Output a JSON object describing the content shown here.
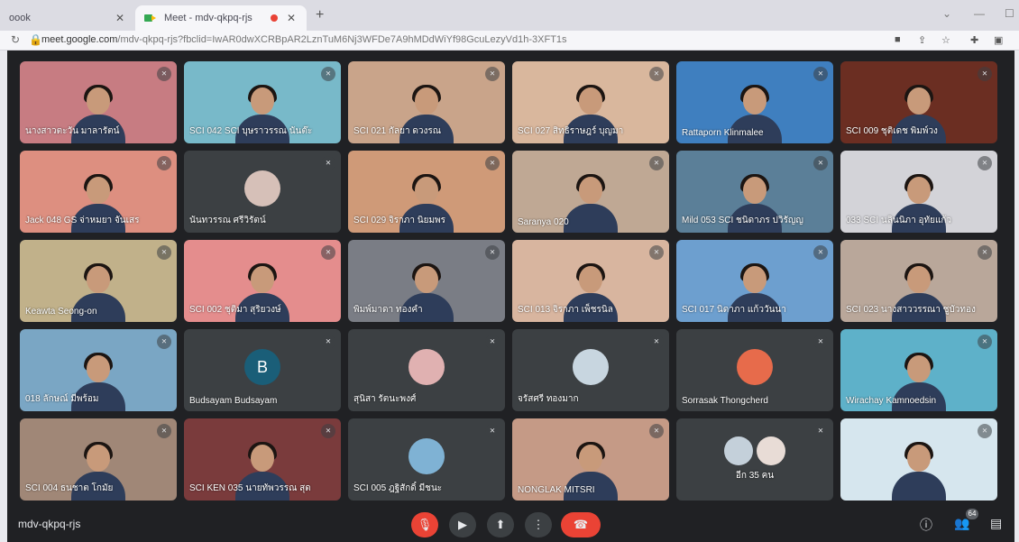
{
  "browser": {
    "tab_inactive": "oook",
    "tab_active": "Meet - mdv-qkpq-rjs",
    "url_host": "meet.google.com",
    "url_path": "/mdv-qkpq-rjs?fbclid=IwAR0dwXCRBpAR2LznTuM6Nj3WFDe7A9hMDdWiYf98GcuLezyVd1h-3XFT1s"
  },
  "meet": {
    "meeting_code": "mdv-qkpq-rjs",
    "participant_count": "64",
    "more_label": "อีก 35 คน",
    "tiles": [
      {
        "name": "นางสาวตะวัน มาลารัตน์",
        "bg": "#c77c82",
        "type": "video",
        "avatar": ""
      },
      {
        "name": "SCI 042 SCI บุษราวรรณ นันต๊ะ",
        "bg": "#78b9c9",
        "type": "video",
        "avatar": ""
      },
      {
        "name": "SCI 021 กัลยา ดวงรณ",
        "bg": "#c9a48a",
        "type": "video",
        "avatar": ""
      },
      {
        "name": "SCI 027 สิทธิราษฎร์ บุญมา",
        "bg": "#d9b79d",
        "type": "video",
        "avatar": ""
      },
      {
        "name": "Rattaporn Klinmalee",
        "bg": "#3f7fbf",
        "type": "video",
        "avatar": ""
      },
      {
        "name": "SCI 009 ชุติเดช พิมพ์วง",
        "bg": "#6b2e22",
        "type": "video",
        "avatar": ""
      },
      {
        "name": "Jack 048 GS จ่าหมยา จันเสร",
        "bg": "#dd8f80",
        "type": "video",
        "avatar": ""
      },
      {
        "name": "นันทวรรณ ศรีวิรัตน์",
        "bg": "#3c4043",
        "type": "avatar",
        "avatar": "",
        "avatar_bg": "#d6c0b8"
      },
      {
        "name": "SCI 029 จิราภา นิยมพร",
        "bg": "#cf9a78",
        "type": "video",
        "avatar": ""
      },
      {
        "name": "Saranya 020",
        "bg": "#bfa894",
        "type": "video",
        "avatar": ""
      },
      {
        "name": "Mild 053 SCI ชนิดาภร ปวิรัญญ",
        "bg": "#5b7f98",
        "type": "video",
        "avatar": ""
      },
      {
        "name": "033 SCI นลินนิภา อุทัยแก้ว",
        "bg": "#d3d3d8",
        "type": "video",
        "avatar": ""
      },
      {
        "name": "Keawta Seong-on",
        "bg": "#c1b18a",
        "type": "video",
        "avatar": ""
      },
      {
        "name": "SCI 002 ชุติมา สุริยวงษ์",
        "bg": "#e48d8d",
        "type": "video",
        "avatar": ""
      },
      {
        "name": "พิมพ์มาดา ทองคำ",
        "bg": "#7a7d85",
        "type": "video",
        "avatar": ""
      },
      {
        "name": "SCI 013 จิราภา เพ็ชรนิล",
        "bg": "#d8b59f",
        "type": "video",
        "avatar": ""
      },
      {
        "name": "SCI 017 นิดาภา แก้ววันนา",
        "bg": "#6d9fcf",
        "type": "video",
        "avatar": ""
      },
      {
        "name": "SCI 023 นางสาววรรณา ชูบัวทอง",
        "bg": "#b9a79a",
        "type": "video",
        "avatar": ""
      },
      {
        "name": "018 ลักษณ์ มีพร้อม",
        "bg": "#7aa6c4",
        "type": "video",
        "avatar": ""
      },
      {
        "name": "Budsayam Budsayam",
        "bg": "#3c4043",
        "type": "avatar",
        "avatar": "B",
        "avatar_bg": "#1a5e78"
      },
      {
        "name": "สุนิสา รัตนะพงศ์",
        "bg": "#3c4043",
        "type": "avatar",
        "avatar": "",
        "avatar_bg": "#e0b1b1"
      },
      {
        "name": "จรัสศรี ทองมาก",
        "bg": "#3c4043",
        "type": "avatar",
        "avatar": "",
        "avatar_bg": "#c8d6e0"
      },
      {
        "name": "Sorrasak Thongcherd",
        "bg": "#3c4043",
        "type": "avatar",
        "avatar": "",
        "avatar_bg": "#e76b4b"
      },
      {
        "name": "Wirachay Kamnoedsin",
        "bg": "#5eb1c9",
        "type": "video",
        "avatar": ""
      },
      {
        "name": "SCI 004 ธนชาต โกมัย",
        "bg": "#a08777",
        "type": "video",
        "avatar": ""
      },
      {
        "name": "SCI KEN 035 นายทัพวรรณ สุด",
        "bg": "#7a3b3c",
        "type": "video",
        "avatar": ""
      },
      {
        "name": "SCI 005 ฎฐิสักดิ์ มีชนะ",
        "bg": "#3c4043",
        "type": "avatar",
        "avatar": "",
        "avatar_bg": "#7fb2d4"
      },
      {
        "name": "NONGLAK MITSRI",
        "bg": "#c59a86",
        "type": "video",
        "avatar": ""
      },
      {
        "name": "อีก 35 คน",
        "bg": "#3c4043",
        "type": "more",
        "avatar": "",
        "avatar_bg": "#c4d0da"
      },
      {
        "name": "",
        "bg": "#d6e6ee",
        "type": "video",
        "avatar": ""
      }
    ]
  }
}
